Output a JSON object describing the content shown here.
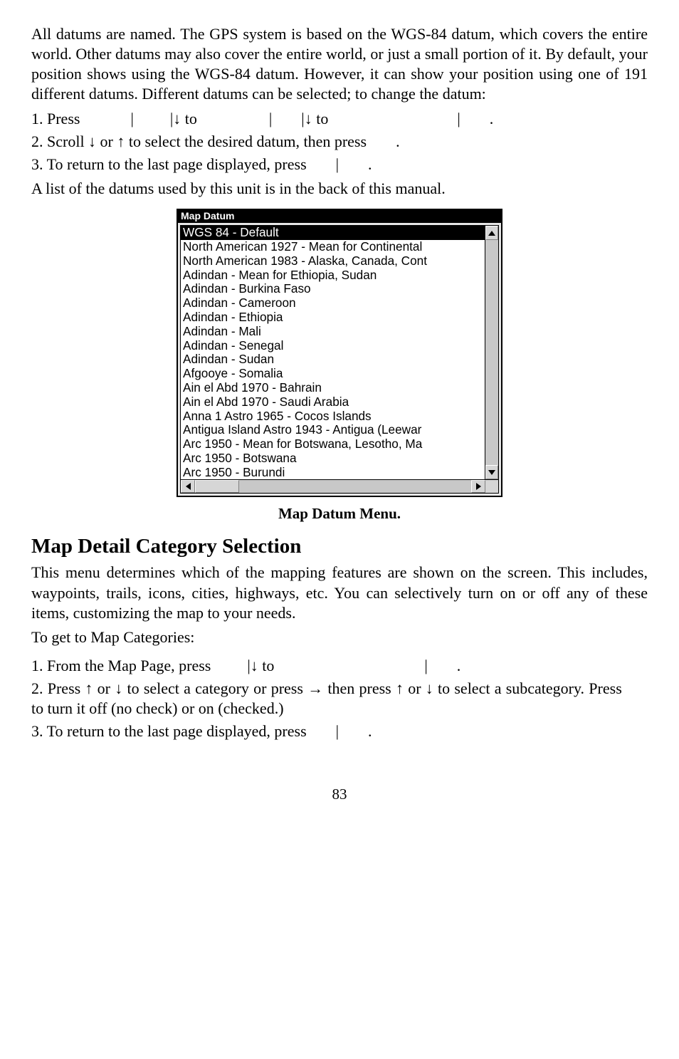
{
  "intro": "All datums are named. The GPS system is based on the WGS-84 datum, which covers the entire world. Other datums may also cover the entire world, or just a small portion of it. By default, your position shows using the WGS-84 datum. However, it can show your position using one of 191 different datums. Different datums can be selected; to change the datum:",
  "steps": {
    "s1a": "1. Press ",
    "s1b": "|",
    "s1c": "|↓ to ",
    "s1d": "|",
    "s1e": "|↓ to ",
    "s1f": "|",
    "s1g": ".",
    "s2a": "2. Scroll ↓ or ↑ to select the desired datum, then press ",
    "s2b": ".",
    "s3a": "3. To return to the last page displayed, press ",
    "s3b": "|",
    "s3c": "."
  },
  "afterSteps": "A list of the datums used by this unit is in the back of this manual.",
  "ui": {
    "title": "Map Datum",
    "items": [
      "WGS 84 - Default",
      "North American 1927 - Mean for Continental",
      "North American 1983 - Alaska, Canada, Cont",
      "Adindan - Mean for Ethiopia, Sudan",
      "Adindan - Burkina Faso",
      "Adindan - Cameroon",
      "Adindan - Ethiopia",
      "Adindan - Mali",
      "Adindan - Senegal",
      "Adindan - Sudan",
      "Afgooye - Somalia",
      "Ain el Abd 1970 - Bahrain",
      "Ain el Abd 1970 - Saudi Arabia",
      "Anna 1 Astro 1965 - Cocos Islands",
      "Antigua Island Astro 1943 - Antigua (Leewar",
      "Arc 1950 - Mean for Botswana, Lesotho, Ma",
      "Arc 1950 - Botswana",
      "Arc 1950 - Burundi"
    ],
    "selectedIndex": 0
  },
  "uiCaption": "Map Datum Menu.",
  "sectionTitle": "Map Detail Category Selection",
  "sectionBody": "This menu determines which of the mapping features are shown on the screen. This includes, waypoints, trails, icons, cities, highways, etc. You can selectively turn on or off any of these items, customizing the map to your needs.",
  "sectionLead": "To get to Map Categories:",
  "sectionSteps": {
    "s1a": "1. From the Map Page, press ",
    "s1b": "|↓ to ",
    "s1c": "|",
    "s1d": ".",
    "s2a": "2. Press ↑ or ↓ to select a category or press → then press ↑ or ↓ to select a subcategory. Press ",
    "s2b": " to turn it off (no check) or on (checked.)",
    "s3a": "3. To return to the last page displayed, press ",
    "s3b": "|",
    "s3c": "."
  },
  "pageNumber": "83"
}
